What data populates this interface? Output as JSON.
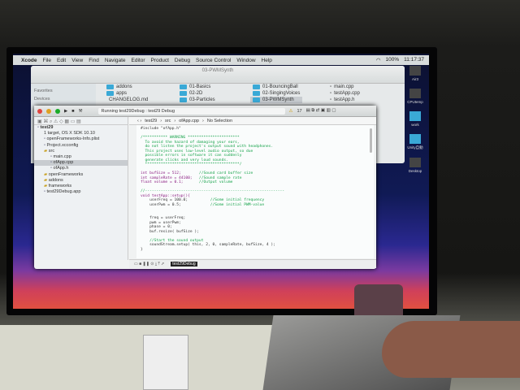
{
  "menubar": {
    "apple": "",
    "items": [
      "Xcode",
      "File",
      "Edit",
      "View",
      "Find",
      "Navigate",
      "Editor",
      "Product",
      "Debug",
      "Source Control",
      "Window",
      "Help"
    ],
    "status": [
      "100%",
      "11:17:37"
    ]
  },
  "finder": {
    "title": "03-PWMSynth",
    "sidebar": [
      "Favorites",
      "Devices"
    ],
    "col1": [
      "addons",
      "apps",
      "CHANGELOG.md"
    ],
    "col2": [
      "01-Basics",
      "02-2D",
      "03-Particles"
    ],
    "col3": [
      "01-BouncingBall",
      "02-SingingVoices",
      "03-PWMSynth"
    ],
    "col4": [
      "main.cpp",
      "testApp.cpp",
      "testApp.h"
    ]
  },
  "xcode": {
    "status": "Running test29Debug : test29 Debug",
    "warnings": "17",
    "jump": [
      "test29",
      "src",
      "ofApp.cpp",
      "No Selection"
    ],
    "tree": [
      {
        "t": "test29",
        "d": 0
      },
      {
        "t": "1 target, OS X SDK 10.10",
        "d": 0
      },
      {
        "t": "openFrameworks-Info.plist",
        "d": 1
      },
      {
        "t": "Project.xcconfig",
        "d": 1
      },
      {
        "t": "src",
        "d": 1
      },
      {
        "t": "main.cpp",
        "d": 2
      },
      {
        "t": "ofApp.cpp",
        "d": 2
      },
      {
        "t": "ofApp.h",
        "d": 2
      },
      {
        "t": "openFrameworks",
        "d": 1
      },
      {
        "t": "addons",
        "d": 1
      },
      {
        "t": "frameworks",
        "d": 1
      },
      {
        "t": "test29Debug.app",
        "d": 1
      }
    ],
    "code": [
      [
        "#include \"ofApp.h\"",
        ""
      ],
      [
        "",
        ""
      ],
      [
        "",
        "/*********** WARNING ***********************"
      ],
      [
        "",
        "  To avoid the hazard of damaging your ears,"
      ],
      [
        "",
        "  do not listen the project's output sound with headphones."
      ],
      [
        "",
        "  This project uses low-level audio output, so due"
      ],
      [
        "",
        "  possible errors in software it can suddenly"
      ],
      [
        "",
        "  generate clicks and very loud sounds."
      ],
      [
        "",
        "  ******************************************/"
      ],
      [
        "",
        ""
      ],
      [
        "int bufSize = 512;        ",
        "//Sound card buffer size"
      ],
      [
        "int sampleRate = 44100;   ",
        "//Sound sample rate"
      ],
      [
        "float volume = 0.1;       ",
        "//Output volume"
      ],
      [
        "",
        ""
      ],
      [
        "",
        "//--------------------------------------------------------------"
      ],
      [
        "void testApp::setup(){",
        ""
      ],
      [
        "    userFreq = 100.0;          ",
        "//Some initial frequency"
      ],
      [
        "    userPwm = 0.5;             ",
        "//Some initial PWM-value"
      ],
      [
        "",
        ""
      ],
      [
        "",
        ""
      ],
      [
        "    freq = userFreq;",
        ""
      ],
      [
        "    pwm = userPwm;",
        ""
      ],
      [
        "    phase = 0;",
        ""
      ],
      [
        "    buf.resize( bufSize );",
        ""
      ],
      [
        "",
        ""
      ],
      [
        "    ",
        "//Start the sound output"
      ],
      [
        "    soundStream.setup( this, 2, 0, sampleRate, bufSize, 4 );",
        ""
      ],
      [
        "}",
        ""
      ]
    ],
    "debug_target": "test29Debug"
  },
  "desktop_icons": [
    "Air3",
    "CPUtemp",
    "work",
    "Unity自動",
    "Desktop"
  ]
}
